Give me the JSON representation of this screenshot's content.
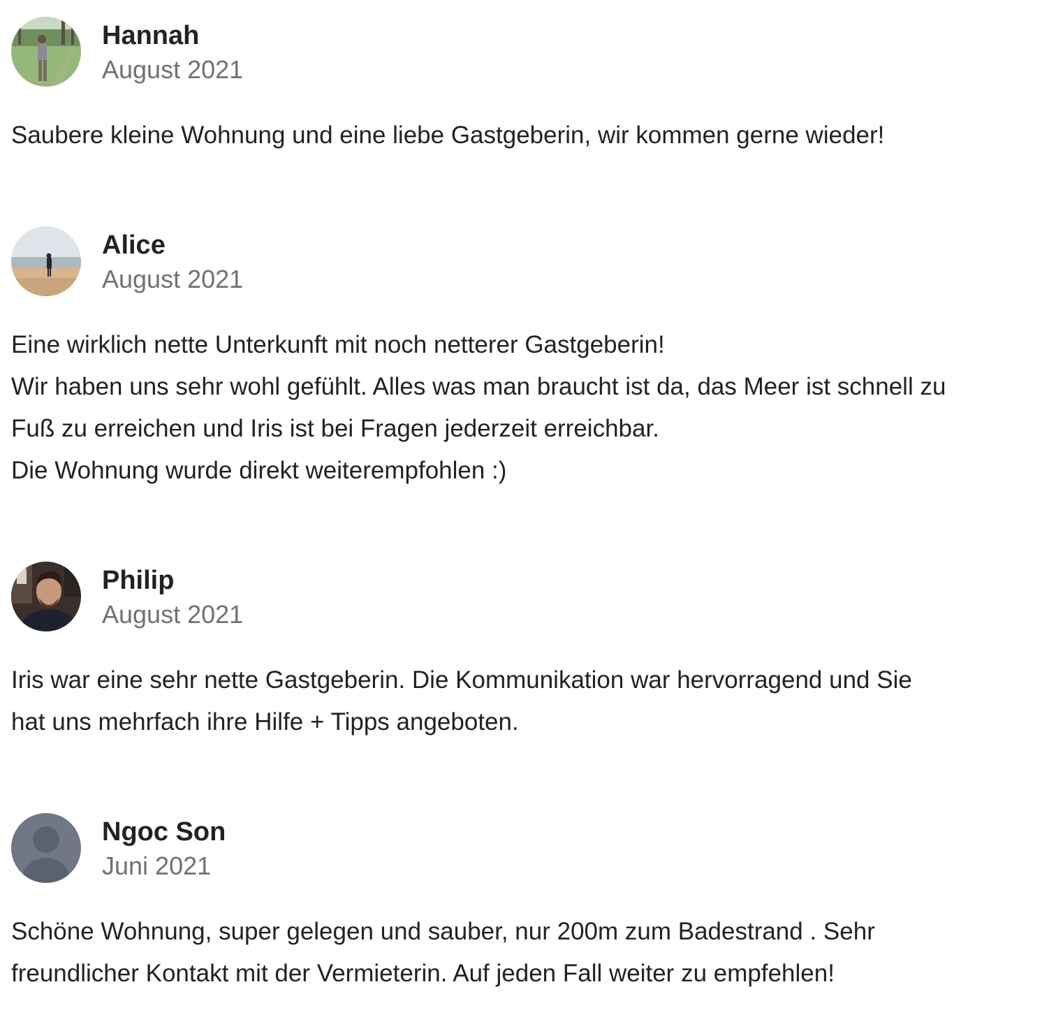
{
  "reviews": [
    {
      "name": "Hannah",
      "date": "August 2021",
      "avatar_icon": "person-in-park-photo",
      "lines": [
        "Saubere kleine Wohnung und eine liebe Gastgeberin, wir kommen gerne wieder!"
      ]
    },
    {
      "name": "Alice",
      "date": "August 2021",
      "avatar_icon": "person-on-beach-photo",
      "lines": [
        "Eine wirklich nette Unterkunft mit noch netterer Gastgeberin!",
        "Wir haben uns sehr wohl gefühlt. Alles was man braucht ist da, das Meer ist schnell zu",
        "Fuß zu erreichen und Iris ist bei Fragen jederzeit erreichbar.",
        "Die Wohnung wurde direkt weiterempfohlen :)"
      ]
    },
    {
      "name": "Philip",
      "date": "August 2021",
      "avatar_icon": "portrait-photo",
      "lines": [
        "Iris war eine sehr nette Gastgeberin. Die Kommunikation war hervorragend und Sie",
        "hat uns mehrfach ihre Hilfe + Tipps angeboten."
      ]
    },
    {
      "name": "Ngoc Son",
      "date": "Juni 2021",
      "avatar_icon": "default-user-icon",
      "lines": [
        "Schöne Wohnung, super gelegen und sauber, nur 200m zum Badestrand . Sehr",
        "freundlicher Kontakt mit der Vermieterin. Auf jeden Fall weiter zu empfehlen!"
      ]
    }
  ]
}
